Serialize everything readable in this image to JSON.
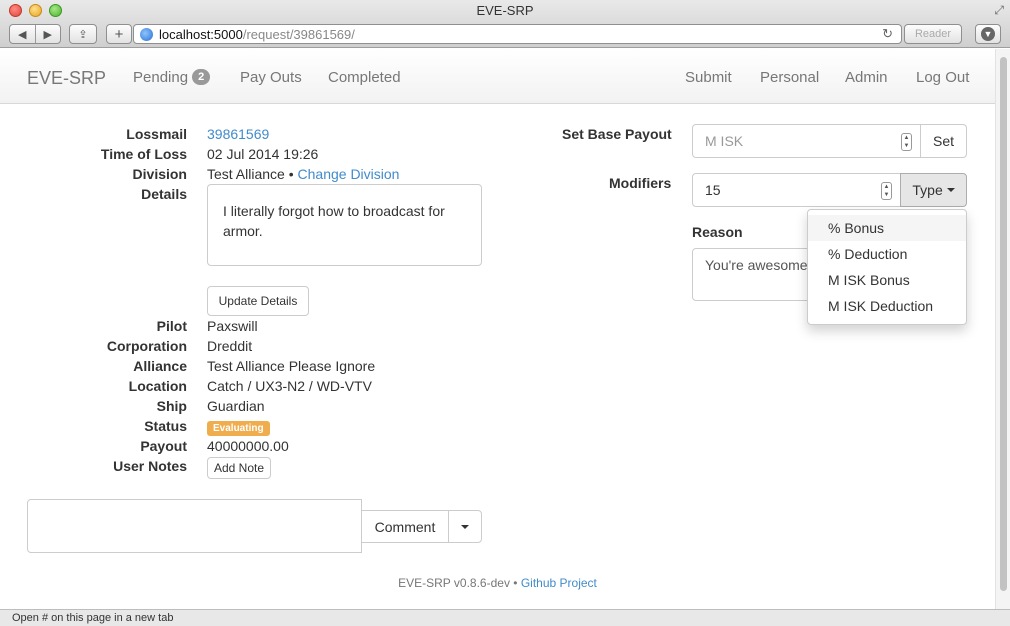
{
  "window": {
    "title": "EVE-SRP"
  },
  "browser": {
    "url_host": "localhost:5000",
    "url_path": "/request/39861569/",
    "reader_label": "Reader",
    "add_label": "+",
    "status_text": "Open # on this page in a new tab"
  },
  "nav": {
    "brand": "EVE-SRP",
    "pending_label": "Pending",
    "pending_count": "2",
    "payouts_label": "Pay Outs",
    "completed_label": "Completed",
    "submit_label": "Submit",
    "personal_label": "Personal",
    "admin_label": "Admin",
    "logout_label": "Log Out"
  },
  "request": {
    "lossmail_label": "Lossmail",
    "lossmail_value": "39861569",
    "time_label": "Time of Loss",
    "time_value": "02 Jul 2014 19:26",
    "division_label": "Division",
    "division_value": "Test Alliance",
    "division_sep": " • ",
    "change_division_label": "Change Division",
    "details_label": "Details",
    "details_text": "I literally forgot how to broadcast for armor.",
    "update_details_label": "Update Details",
    "pilot_label": "Pilot",
    "pilot_value": "Paxswill",
    "corp_label": "Corporation",
    "corp_value": "Dreddit",
    "alliance_label": "Alliance",
    "alliance_value": "Test Alliance Please Ignore",
    "location_label": "Location",
    "location_value": "Catch / UX3-N2 / WD-VTV",
    "ship_label": "Ship",
    "ship_value": "Guardian",
    "status_label": "Status",
    "status_value": "Evaluating",
    "payout_label": "Payout",
    "payout_value": "40000000.00",
    "notes_label": "User Notes",
    "add_note_label": "Add Note"
  },
  "comment": {
    "button_label": "Comment"
  },
  "payout_form": {
    "base_label": "Set Base Payout",
    "base_placeholder": "M ISK",
    "set_label": "Set",
    "modifiers_label": "Modifiers",
    "modifier_value": "15",
    "type_label": "Type",
    "reason_label": "Reason",
    "reason_value": "You're awesome",
    "type_options": [
      "% Bonus",
      "% Deduction",
      "M ISK Bonus",
      "M ISK Deduction"
    ]
  },
  "footer": {
    "version": "EVE-SRP v0.8.6-dev",
    "sep": " • ",
    "github_label": "Github Project"
  },
  "colors": {
    "link": "#428bca",
    "status_evaluating": "#f0ad4e",
    "badge": "#999999"
  }
}
